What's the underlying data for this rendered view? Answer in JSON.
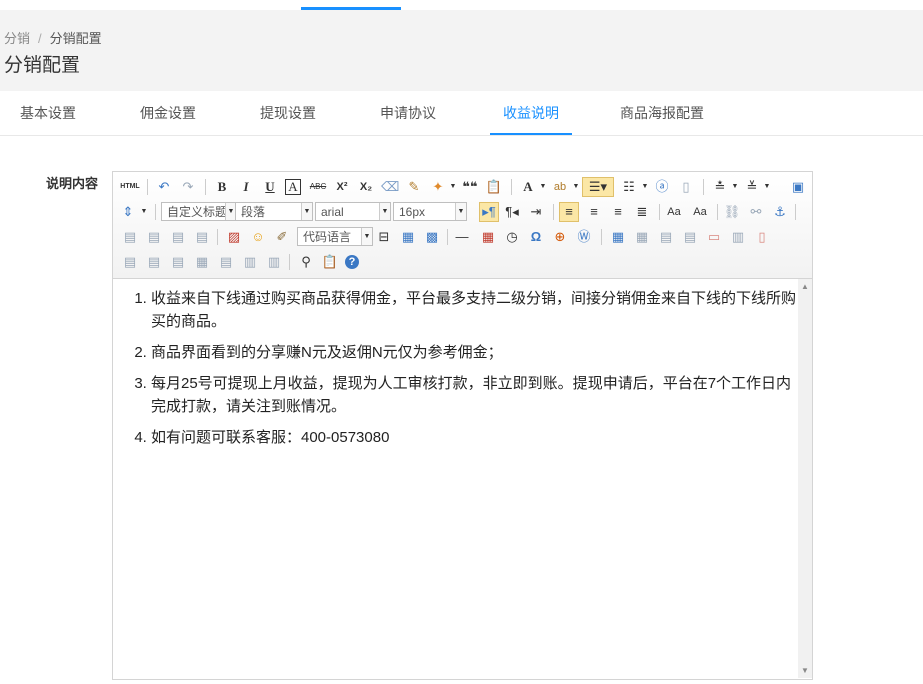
{
  "breadcrumb": {
    "root": "分销",
    "separator": "/",
    "current": "分销配置"
  },
  "page_title": "分销配置",
  "tabs": [
    {
      "label": "基本设置"
    },
    {
      "label": "佣金设置"
    },
    {
      "label": "提现设置"
    },
    {
      "label": "申请协议"
    },
    {
      "label": "收益说明",
      "active": true
    },
    {
      "label": "商品海报配置"
    }
  ],
  "form": {
    "label": "说明内容"
  },
  "toolbar": {
    "html_label": "HTML",
    "bold": "B",
    "italic": "I",
    "underline": "U",
    "font_border": "A",
    "strike": "ABC",
    "superscript": "X²",
    "subscript": "X₂",
    "quote": "❝❝",
    "font_color": "A",
    "combo_title": "自定义标题",
    "combo_paragraph": "段落",
    "combo_font": "arial",
    "combo_size": "16px",
    "combo_code": "代码语言",
    "omega": "Ω"
  },
  "content": {
    "items": [
      "收益来自下线通过购买商品获得佣金，平台最多支持二级分销，间接分销佣金来自下线的下线所购买的商品。",
      "商品界面看到的分享赚N元及返佣N元仅为参考佣金；",
      "每月25号可提现上月收益，提现为人工审核打款，非立即到账。提现申请后，平台在7个工作日内完成打款，请关注到账情况。",
      "如有问题可联系客服：400-0573080"
    ]
  },
  "colors": {
    "accent": "#1890ff",
    "header_bg": "#f3f3f3",
    "selected_btn": "#fbe7a6"
  }
}
